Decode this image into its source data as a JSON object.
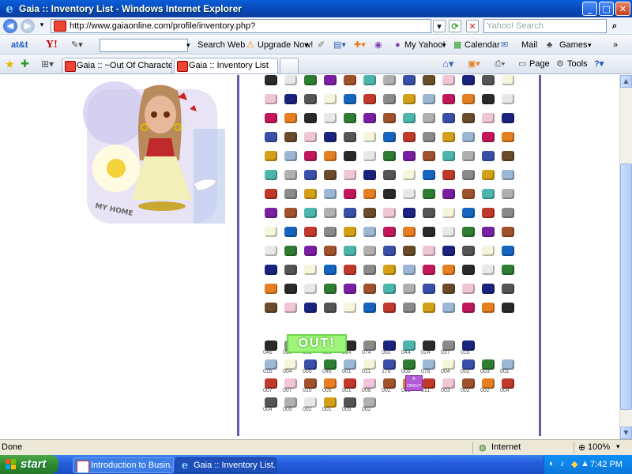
{
  "window": {
    "title": "Gaia :: Inventory List - Windows Internet Explorer",
    "controls": [
      "_",
      "□",
      "✕"
    ]
  },
  "address_bar": {
    "url": "http://www.gaiaonline.com/profile/inventory.php?",
    "search_placeholder": "Yahoo! Search"
  },
  "yahoo_toolbar": {
    "brand": "at&t",
    "logo": "Y!",
    "search_button": "Search Web",
    "upgrade": "Upgrade Now!",
    "my_yahoo": "My Yahoo!",
    "calendar": "Calendar",
    "mail": "Mail",
    "games": "Games"
  },
  "tabs": [
    {
      "label": "Gaia :: ~Out Of Character~",
      "active": false
    },
    {
      "label": "Gaia :: Inventory List",
      "active": true
    }
  ],
  "command_bar": {
    "page": "Page",
    "tools": "Tools"
  },
  "content": {
    "avatar_badge": "MY HOME",
    "outfit_sign": "OUT!",
    "item_colors": [
      "#2a2a2a",
      "#3a4fa8",
      "#c0392b",
      "#e8e8e8",
      "#6b4c2a",
      "#8a8a8a",
      "#2e7d32",
      "#f0c6d6",
      "#d4a017",
      "#7b1fa2",
      "#1a237e",
      "#9bb7d4",
      "#a0522d",
      "#555555",
      "#c2185b",
      "#4db6ac",
      "#f5f5dc",
      "#e67e22",
      "#b0b0b0",
      "#1565c0"
    ],
    "quantity_rows": [
      [
        "046",
        "050",
        "032",
        "021",
        "034",
        "074",
        "002",
        "044",
        "024",
        "037",
        "016"
      ],
      [
        "016",
        "004",
        "005",
        "046",
        "001",
        "011",
        "176",
        "005",
        "078",
        "004",
        "002",
        "003",
        "001"
      ],
      [
        "007",
        "007",
        "010",
        "005",
        "001",
        "008",
        "002",
        "001",
        "011",
        "003",
        "002",
        "002",
        "004"
      ],
      [
        "004",
        "005",
        "002",
        "001",
        "005",
        "002"
      ]
    ],
    "special_item_label": "B ORGVT"
  },
  "status_bar": {
    "text": "Done",
    "zone": "Internet",
    "zoom": "100%"
  },
  "taskbar": {
    "start": "start",
    "tasks": [
      {
        "label": "Introduction to Busin...",
        "active": false
      },
      {
        "label": "Gaia :: Inventory List...",
        "active": true
      }
    ],
    "clock": "7:42 PM"
  }
}
